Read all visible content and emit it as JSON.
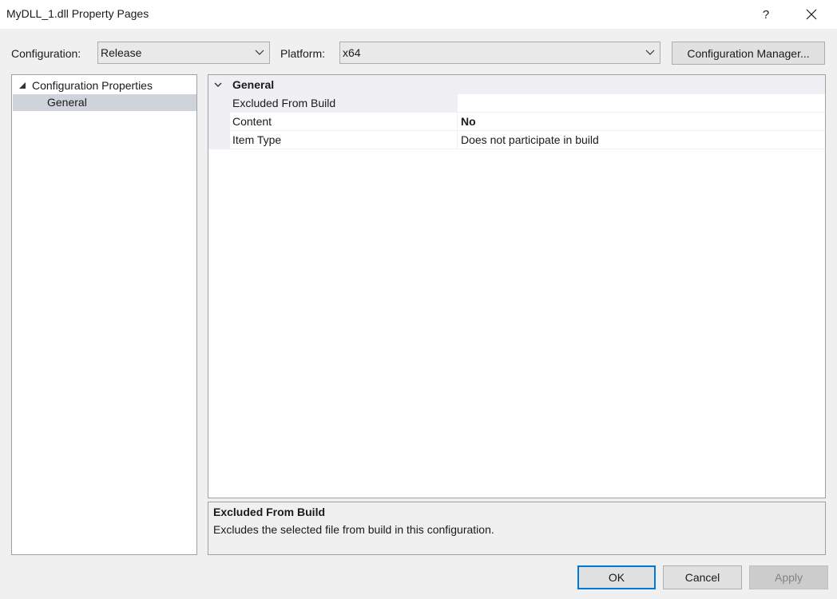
{
  "window": {
    "title": "MyDLL_1.dll Property Pages",
    "help_label": "?"
  },
  "toolbar": {
    "configuration_label": "Configuration:",
    "configuration_value": "Release",
    "platform_label": "Platform:",
    "platform_value": "x64",
    "config_manager_label": "Configuration Manager..."
  },
  "tree": {
    "root_label": "Configuration Properties",
    "children": [
      {
        "label": "General",
        "selected": true
      }
    ]
  },
  "grid": {
    "category": "General",
    "properties": [
      {
        "name": "Excluded From Build",
        "value": ""
      },
      {
        "name": "Content",
        "value": "No"
      },
      {
        "name": "Item Type",
        "value": "Does not participate in build"
      }
    ]
  },
  "description": {
    "title": "Excluded From Build",
    "text": "Excludes the selected file from build in this configuration."
  },
  "buttons": {
    "ok": "OK",
    "cancel": "Cancel",
    "apply": "Apply"
  },
  "colors": {
    "accent": "#0078d7",
    "selection": "#cfd3dc",
    "gutter": "#f0f0f4"
  }
}
